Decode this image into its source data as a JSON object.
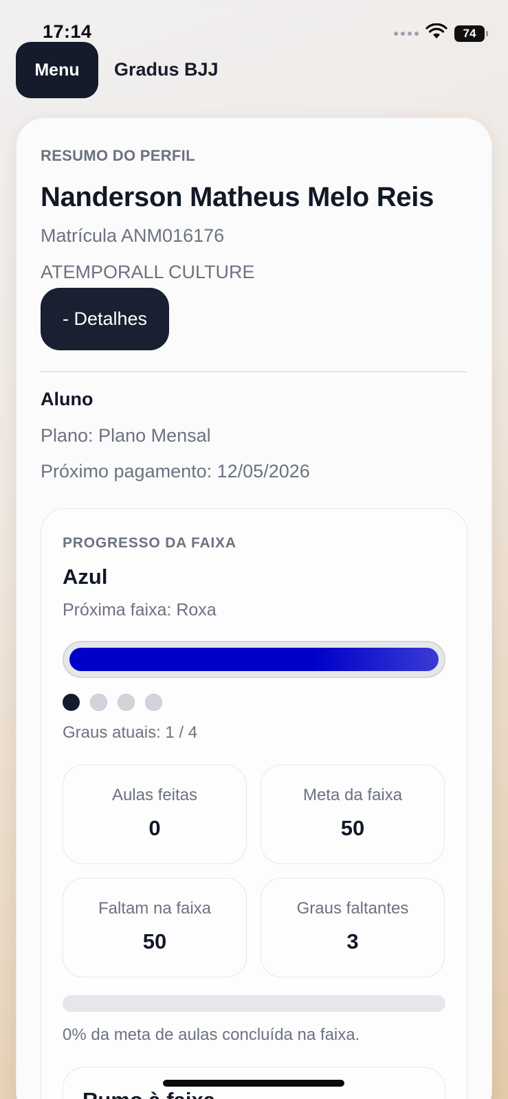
{
  "status_bar": {
    "time": "17:14",
    "battery": "74"
  },
  "header": {
    "menu_label": "Menu",
    "app_title": "Gradus BJJ"
  },
  "profile": {
    "section_label": "RESUMO DO PERFIL",
    "name": "Nanderson Matheus Melo Reis",
    "registration": "Matrícula ANM016176",
    "academy": "ATEMPORALL CULTURE",
    "details_button": "- Detalhes",
    "role": "Aluno",
    "plan": "Plano: Plano Mensal",
    "next_payment": "Próximo pagamento: 12/05/2026"
  },
  "belt_progress": {
    "section_label": "PROGRESSO DA FAIXA",
    "current_belt": "Azul",
    "next_belt": "Próxima faixa: Roxa",
    "progress_fraction": 1.0,
    "bar_color": "#0000c8",
    "degrees_filled": 1,
    "degrees_total": 4,
    "degrees_text": "Graus atuais: 1 / 4",
    "stats": [
      {
        "label": "Aulas feitas",
        "value": "0"
      },
      {
        "label": "Meta da faixa",
        "value": "50"
      },
      {
        "label": "Faltam na faixa",
        "value": "50"
      },
      {
        "label": "Graus faltantes",
        "value": "3"
      }
    ],
    "goal_fraction": 0,
    "goal_text": "0% da meta de aulas concluída na faixa."
  },
  "next_section": {
    "title": "Rumo à faixa"
  }
}
